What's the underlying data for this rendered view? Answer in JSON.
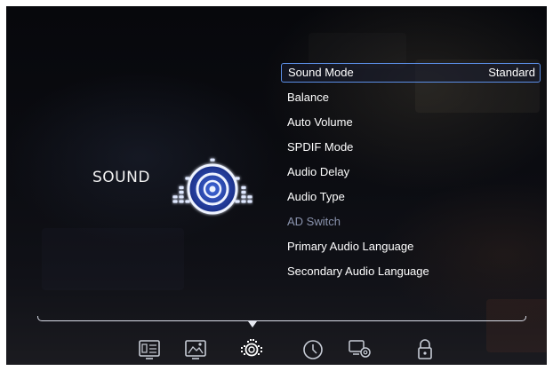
{
  "section": {
    "title": "SOUND",
    "icon": "sound-equalizer-icon"
  },
  "menu": {
    "items": [
      {
        "label": "Sound Mode",
        "value": "Standard",
        "state": "selected"
      },
      {
        "label": "Balance",
        "value": "",
        "state": "normal"
      },
      {
        "label": "Auto Volume",
        "value": "",
        "state": "normal"
      },
      {
        "label": "SPDIF Mode",
        "value": "",
        "state": "normal"
      },
      {
        "label": "Audio Delay",
        "value": "",
        "state": "normal"
      },
      {
        "label": "Audio Type",
        "value": "",
        "state": "normal"
      },
      {
        "label": "AD Switch",
        "value": "",
        "state": "disabled"
      },
      {
        "label": "Primary Audio Language",
        "value": "",
        "state": "normal"
      },
      {
        "label": "Secondary Audio Language",
        "value": "",
        "state": "normal"
      }
    ]
  },
  "bottom_nav": {
    "items": [
      {
        "icon": "channel-icon",
        "active": false
      },
      {
        "icon": "picture-icon",
        "active": false
      },
      {
        "icon": "sound-icon",
        "active": true
      },
      {
        "icon": "clock-icon",
        "active": false
      },
      {
        "icon": "settings-icon",
        "active": false
      },
      {
        "icon": "lock-icon",
        "active": false
      }
    ]
  },
  "colors": {
    "selection_border": "#5b8ee6",
    "disabled_text": "#8a93ad",
    "icon_glow": "#d6e4ff",
    "icon_body": "#2c48b8"
  }
}
